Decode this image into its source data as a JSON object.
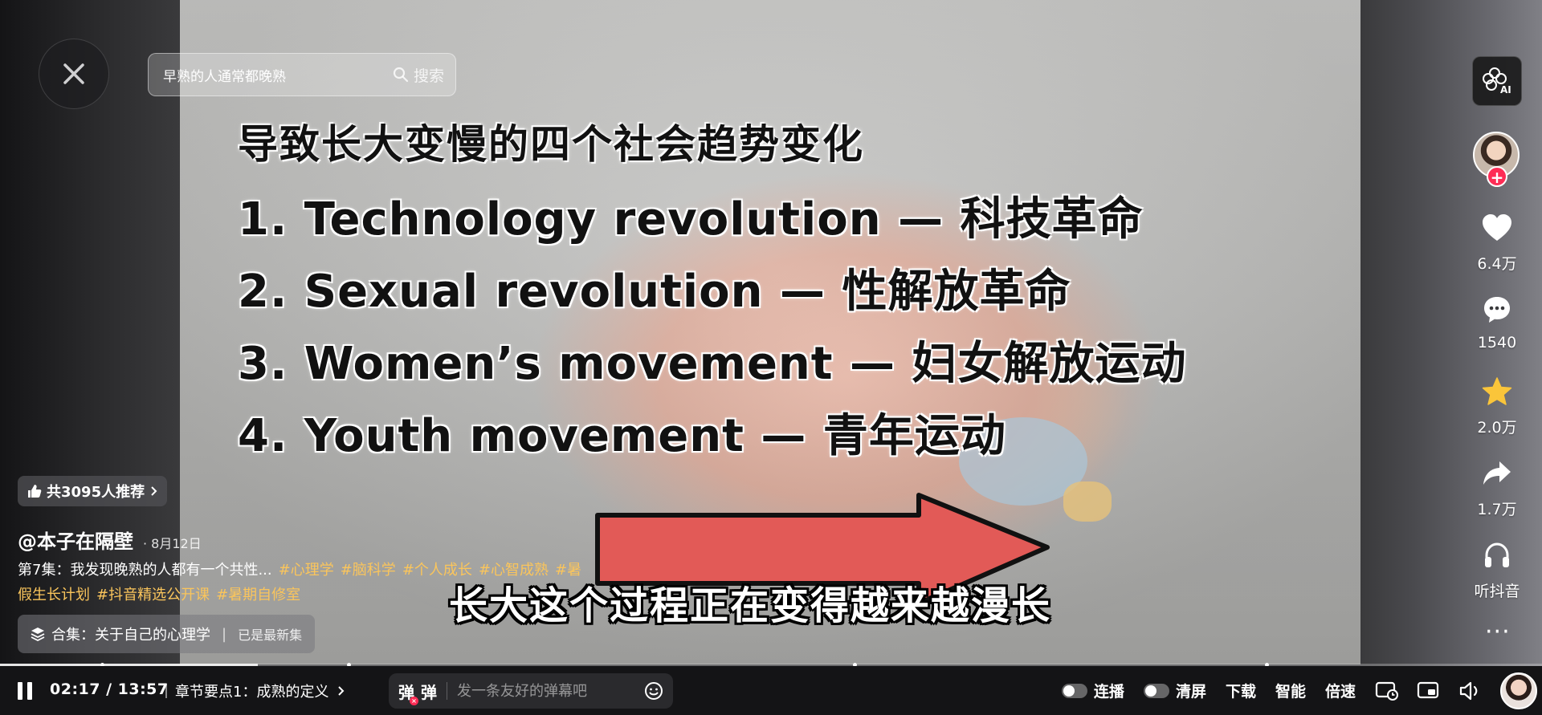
{
  "search": {
    "value": "早熟的人通常都晚熟",
    "button_label": "搜索"
  },
  "video": {
    "slide_title": "导致长大变慢的四个社会趋势变化",
    "slide_lines": [
      "1. Technology revolution — 科技革命",
      "2. Sexual revolution — 性解放革命",
      "3. Women’s movement — 妇女解放运动",
      "4. Youth movement — 青年运动"
    ],
    "subtitle": "长大这个过程正在变得越来越漫长"
  },
  "rail": {
    "ai_label": "AI",
    "likes": "6.4万",
    "comments": "1540",
    "favorites": "2.0万",
    "shares": "1.7万",
    "listen": "听抖音",
    "more": "···"
  },
  "info": {
    "recommend": "共3095人推荐",
    "author": "@本子在隔壁",
    "date": "8月12日",
    "desc_text": "第7集：我发现晚熟的人都有一个共性...",
    "tags": [
      "#心理学",
      "#脑科学",
      "#个人成长",
      "#心智成熟",
      "#暑假生长计划",
      "#抖音精选公开课",
      "#暑期自修室"
    ],
    "collection_label": "合集：关于自己的心理学",
    "collection_status": "已是最新集"
  },
  "player": {
    "progress": 0.167,
    "time": "02:17 / 13:57",
    "chapter": "章节要点1：成熟的定义",
    "danmu_toggle_1": "弹",
    "danmu_toggle_2": "弹",
    "danmu_placeholder": "发一条友好的弹幕吧",
    "autoplay_label": "连播",
    "clear_label": "清屏",
    "download_label": "下载",
    "quality_label": "智能",
    "speed_label": "倍速"
  }
}
